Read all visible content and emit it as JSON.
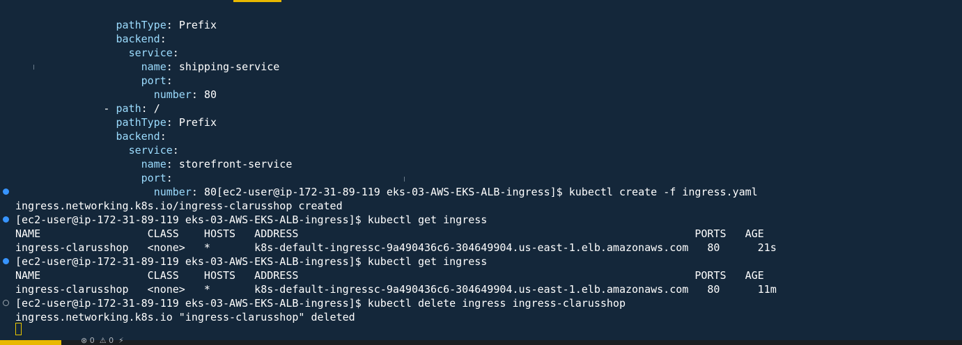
{
  "terminal": {
    "yaml": [
      {
        "indent": "      ",
        "key": "pathType",
        "value": "Prefix"
      },
      {
        "indent": "      ",
        "key": "backend",
        "value": ""
      },
      {
        "indent": "        ",
        "key": "service",
        "value": ""
      },
      {
        "indent": "          ",
        "key": "name",
        "value": "shipping-service"
      },
      {
        "indent": "          ",
        "key": "port",
        "value": ""
      },
      {
        "indent": "            ",
        "key": "number",
        "value": "80"
      },
      {
        "indent": "    - ",
        "key": "path",
        "value": "/"
      },
      {
        "indent": "      ",
        "key": "pathType",
        "value": "Prefix"
      },
      {
        "indent": "      ",
        "key": "backend",
        "value": ""
      },
      {
        "indent": "        ",
        "key": "service",
        "value": ""
      },
      {
        "indent": "          ",
        "key": "name",
        "value": "storefront-service"
      },
      {
        "indent": "          ",
        "key": "port",
        "value": ""
      }
    ],
    "last_yaml": {
      "indent": "            ",
      "key": "number",
      "value": "80"
    },
    "prompt": "[ec2-user@ip-172-31-89-119 eks-03-AWS-EKS-ALB-ingress]$",
    "cmd_create": "kubectl create -f ingress.yaml",
    "out_create": "ingress.networking.k8s.io/ingress-clarusshop created",
    "cmd_get": "kubectl get ingress",
    "table_header": "NAME                 CLASS    HOSTS   ADDRESS                                                               PORTS   AGE",
    "row1": "ingress-clarusshop   <none>   *       k8s-default-ingressc-9a490436c6-304649904.us-east-1.elb.amazonaws.com   80      21s",
    "row2": "ingress-clarusshop   <none>   *       k8s-default-ingressc-9a490436c6-304649904.us-east-1.elb.amazonaws.com   80      11m",
    "cmd_delete": "kubectl delete ingress ingress-clarusshop",
    "out_delete": "ingress.networking.k8s.io \"ingress-clarusshop\" deleted"
  },
  "statusbar": {
    "text": "⊗ 0  ⚠ 0  ⚡"
  },
  "colors": {
    "background": "#14273a",
    "yaml_key": "#9cdcfe",
    "text": "#ffffff",
    "success_marker": "#3794ff",
    "cursor": "#e8c600",
    "status_accent": "#e8b800"
  }
}
